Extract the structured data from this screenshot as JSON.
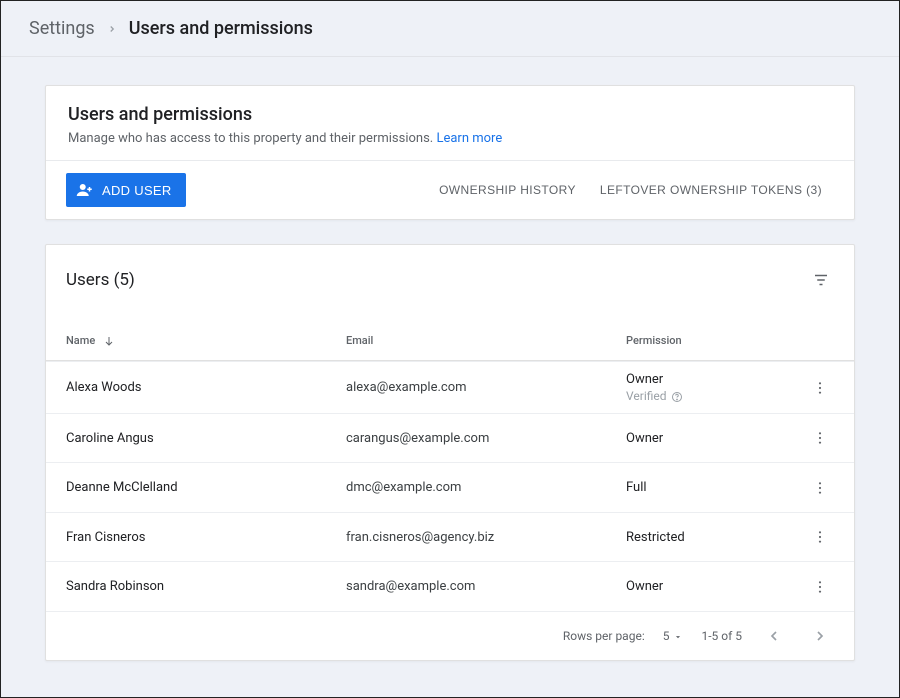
{
  "breadcrumb": {
    "parent": "Settings",
    "current": "Users and permissions"
  },
  "header": {
    "title": "Users and permissions",
    "subtitle": "Manage who has access to this property and their permissions.",
    "learn_more": "Learn more"
  },
  "toolbar": {
    "add_user": "ADD USER",
    "ownership_history": "OWNERSHIP HISTORY",
    "leftover_tokens": "LEFTOVER OWNERSHIP TOKENS (3)"
  },
  "table": {
    "title": "Users (5)",
    "columns": {
      "name": "Name",
      "email": "Email",
      "permission": "Permission"
    },
    "verified_label": "Verified",
    "rows": [
      {
        "name": "Alexa Woods",
        "email": "alexa@example.com",
        "permission": "Owner",
        "verified": true
      },
      {
        "name": "Caroline Angus",
        "email": "carangus@example.com",
        "permission": "Owner",
        "verified": false
      },
      {
        "name": "Deanne McClelland",
        "email": "dmc@example.com",
        "permission": "Full",
        "verified": false
      },
      {
        "name": "Fran Cisneros",
        "email": "fran.cisneros@agency.biz",
        "permission": "Restricted",
        "verified": false
      },
      {
        "name": "Sandra Robinson",
        "email": "sandra@example.com",
        "permission": "Owner",
        "verified": false
      }
    ]
  },
  "pager": {
    "rows_per_page_label": "Rows per page:",
    "rows_per_page_value": "5",
    "range": "1-5 of 5"
  }
}
